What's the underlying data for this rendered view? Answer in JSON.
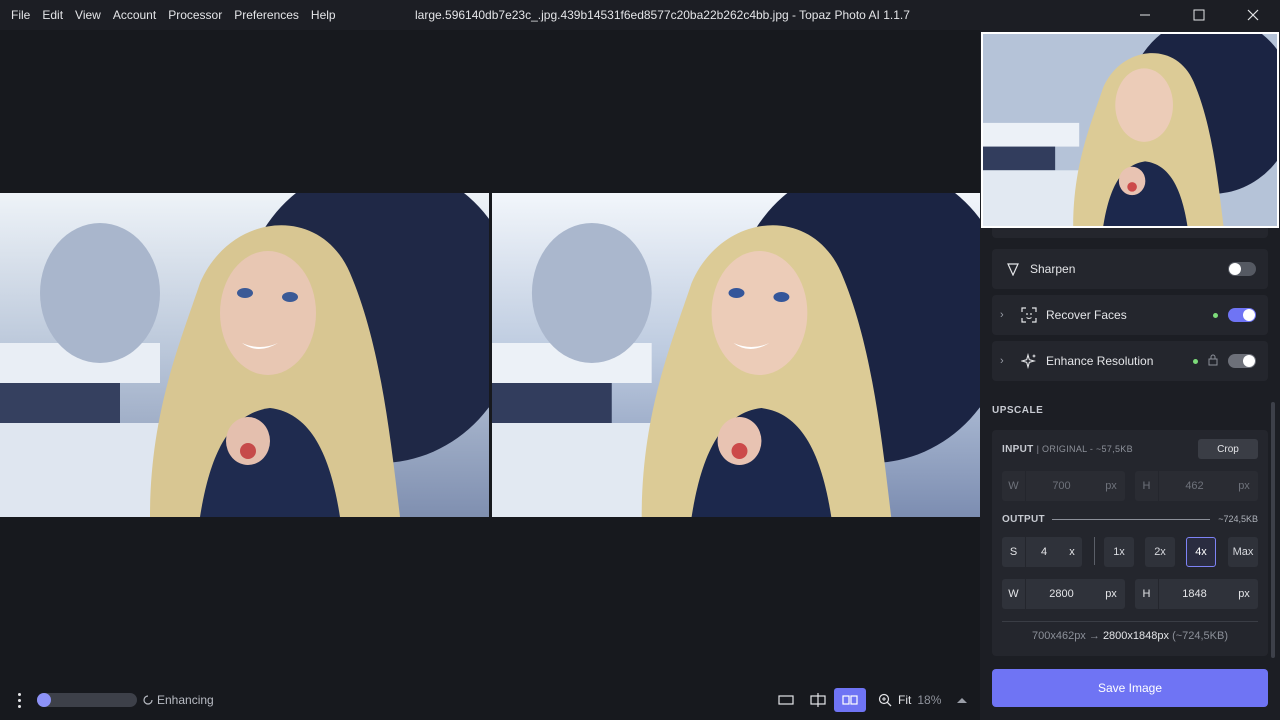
{
  "menu": [
    "File",
    "Edit",
    "View",
    "Account",
    "Processor",
    "Preferences",
    "Help"
  ],
  "window": {
    "title": "large.596140db7e23c_.jpg.439b14531f6ed8577c20ba22b262c4bb.jpg - Topaz Photo AI 1.1.7",
    "controls": [
      "minimize-icon",
      "maximize-icon",
      "close-icon"
    ]
  },
  "bottom": {
    "status": "Enhancing",
    "progress": 0.1,
    "view_modes": [
      "single-view-icon",
      "split-view-icon",
      "side-by-side-icon"
    ],
    "active_view": 2,
    "zoom_label": "Fit",
    "zoom_pct": "18%"
  },
  "modules": [
    {
      "label": "Sharpen",
      "icon": "sharpen-icon",
      "expandable": false,
      "dot": false,
      "lock": false,
      "toggle": "off"
    },
    {
      "label": "Recover Faces",
      "icon": "face-icon",
      "expandable": true,
      "dot": true,
      "lock": false,
      "toggle": "on"
    },
    {
      "label": "Enhance Resolution",
      "icon": "sparkle-icon",
      "expandable": true,
      "dot": true,
      "lock": true,
      "toggle": "grey"
    }
  ],
  "upscale": {
    "title": "UPSCALE",
    "input": {
      "label": "INPUT",
      "sub": "| ORIGINAL - ~57,5KB",
      "crop": "Crop",
      "w_key": "W",
      "w_val": "700",
      "w_unit": "px",
      "h_key": "H",
      "h_val": "462",
      "h_unit": "px"
    },
    "output": {
      "label": "OUTPUT",
      "size": "~724,5KB",
      "s_key": "S",
      "s_val": "4",
      "s_unit": "x",
      "scales": [
        "1x",
        "2x",
        "4x",
        "Max"
      ],
      "selected_scale": 2,
      "w_key": "W",
      "w_val": "2800",
      "w_unit": "px",
      "h_key": "H",
      "h_val": "1848",
      "h_unit": "px"
    },
    "summary_from": "700x462px",
    "summary_arrow": "→",
    "summary_to": "2800x1848px",
    "summary_size": "(~724,5KB)"
  },
  "save_label": "Save Image",
  "colors": {
    "accent": "#6f74f4",
    "active_dot": "#7ddc7a",
    "panel_bg": "#1c1e24"
  }
}
